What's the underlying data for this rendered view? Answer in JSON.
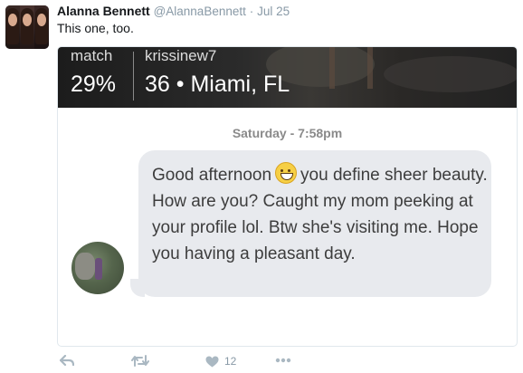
{
  "tweet": {
    "author_name": "Alanna Bennett",
    "handle": "@AlannaBennett",
    "separator": "·",
    "date": "Jul 25",
    "text": "This one, too."
  },
  "media": {
    "banner": {
      "match_label": "match",
      "match_value": "29%",
      "username": "krissinew7",
      "age_location": "36 • Miami, FL"
    },
    "conversation": {
      "timestamp": "Saturday - 7:58pm",
      "message_part1": "Good afternoon",
      "emoji": "grinning-face-emoji",
      "message_part2": "you define sheer beauty. How are you? Caught my mom peeking at your profile lol. Btw she's visiting me. Hope you having a pleasant day."
    }
  },
  "actions": {
    "like_count": "12",
    "icons": [
      "reply-icon",
      "retweet-icon",
      "heart-icon",
      "more-icon"
    ]
  },
  "colors": {
    "icon_gray": "#aab8c2",
    "bubble": "#e8eaee",
    "text_gray": "#8899a6"
  }
}
